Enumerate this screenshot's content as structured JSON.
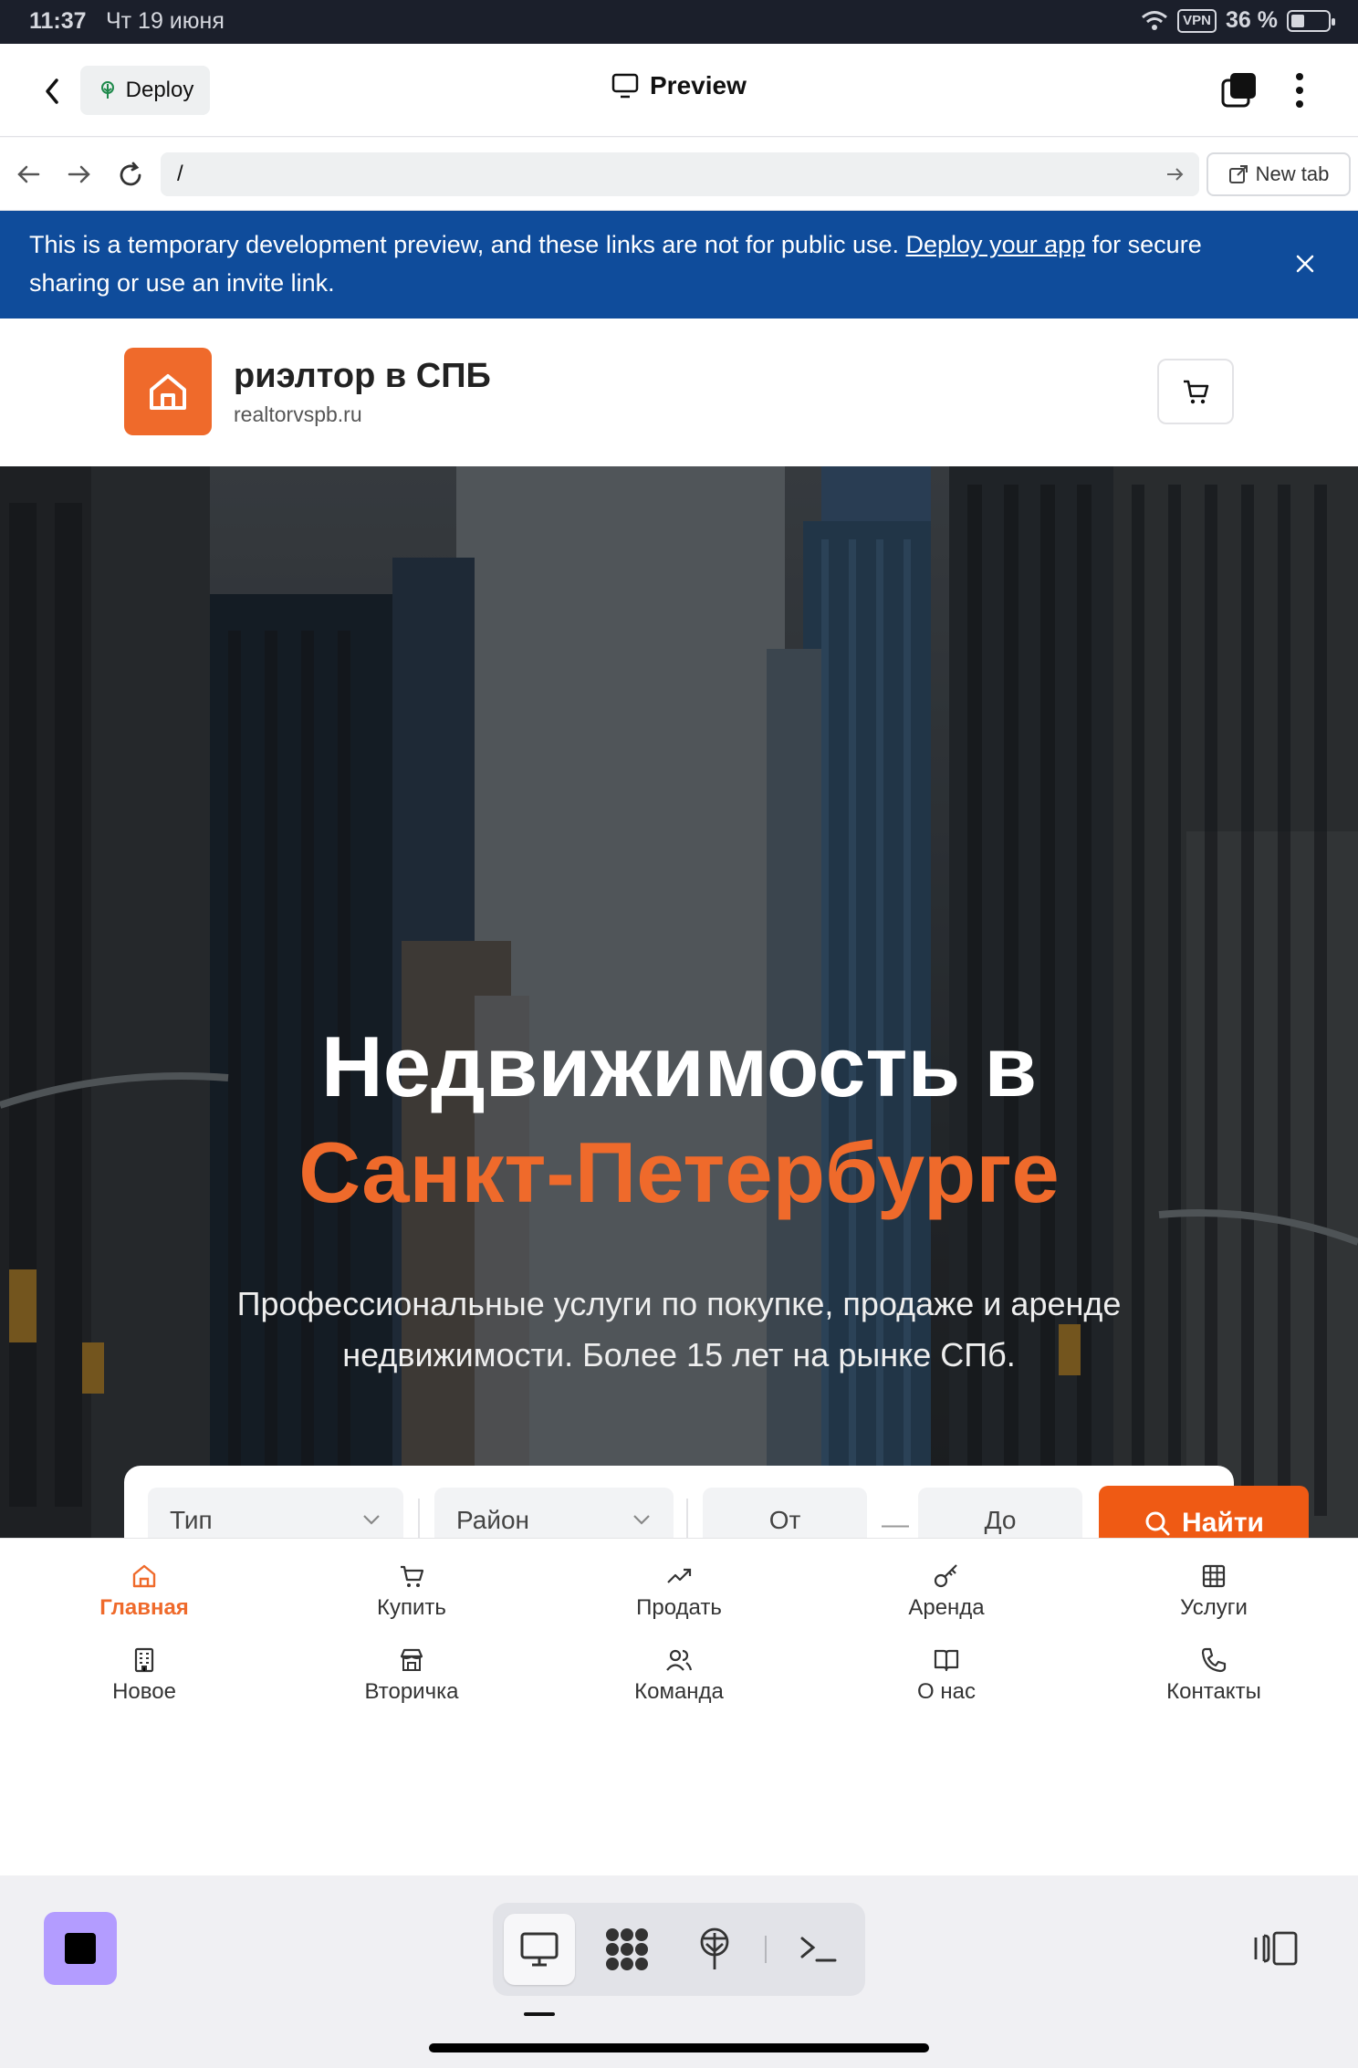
{
  "status_bar": {
    "time": "11:37",
    "date": "Чт 19 июня",
    "vpn": "VPN",
    "battery": "36 %"
  },
  "app_header": {
    "deploy_label": "Deploy",
    "title": "Preview"
  },
  "url_bar": {
    "url": "/",
    "new_tab_label": "New tab"
  },
  "banner": {
    "text_before": "This is a temporary development preview, and these links are not for public use.",
    "link": "Deploy your app",
    "text_after": "for secure sharing or use an invite link."
  },
  "site": {
    "brand": "риэлтор в СПБ",
    "domain": "realtorvspb.ru"
  },
  "hero": {
    "title_line1": "Недвижимость в",
    "title_line2": "Санкт-Петербурге",
    "subtitle": "Профессиональные услуги по покупке, продаже и аренде недвижимости. Более 15 лет на рынке СПб."
  },
  "search": {
    "type_placeholder": "Тип",
    "district_placeholder": "Район",
    "from_placeholder": "От",
    "dash": "—",
    "to_placeholder": "До",
    "find_label": "Найти"
  },
  "nav": {
    "row1": [
      {
        "label": "Главная",
        "icon": "home-icon",
        "active": true
      },
      {
        "label": "Купить",
        "icon": "cart-icon"
      },
      {
        "label": "Продать",
        "icon": "trending-up-icon"
      },
      {
        "label": "Аренда",
        "icon": "key-icon"
      },
      {
        "label": "Услуги",
        "icon": "grid-icon"
      }
    ],
    "row2": [
      {
        "label": "Новое",
        "icon": "building-icon"
      },
      {
        "label": "Вторичка",
        "icon": "store-icon"
      },
      {
        "label": "Команда",
        "icon": "users-icon"
      },
      {
        "label": "О нас",
        "icon": "book-icon"
      },
      {
        "label": "Контакты",
        "icon": "phone-icon"
      }
    ]
  },
  "colors": {
    "accent": "#ef6a2b",
    "banner": "#0f4c9b",
    "stop": "#b39cff"
  }
}
